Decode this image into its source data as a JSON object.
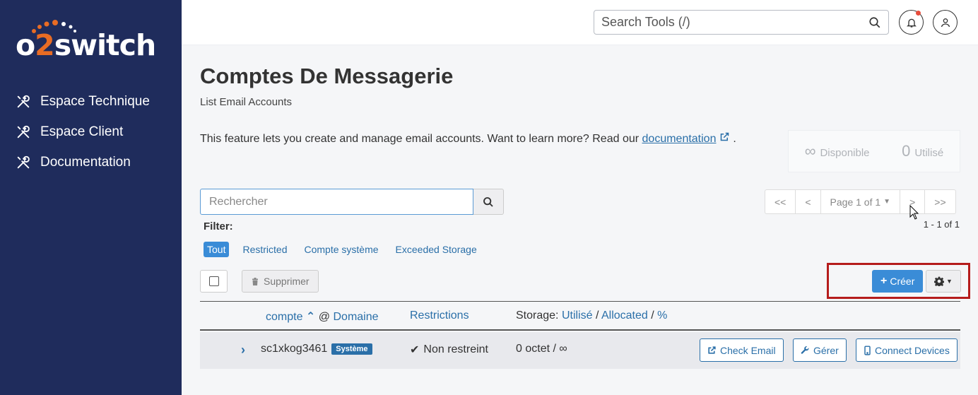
{
  "sidebar": {
    "brand": {
      "o": "o",
      "two": "2",
      "rest": "switch"
    },
    "items": [
      {
        "label": "Espace Technique",
        "icon": "tools-icon"
      },
      {
        "label": "Espace Client",
        "icon": "tools-icon"
      },
      {
        "label": "Documentation",
        "icon": "tools-icon"
      }
    ]
  },
  "topbar": {
    "search_placeholder": "Search Tools (/)"
  },
  "page": {
    "title": "Comptes De Messagerie",
    "subtitle": "List Email Accounts",
    "intro_text": "This feature lets you create and manage email accounts. Want to learn more? Read our ",
    "intro_link": "documentation",
    "intro_end": "."
  },
  "stats": {
    "available_symbol": "∞",
    "available_label": "Disponible",
    "used_value": "0",
    "used_label": "Utilisé"
  },
  "search": {
    "placeholder": "Rechercher"
  },
  "pager": {
    "first": "<<",
    "prev": "<",
    "page_label": "Page 1 of 1",
    "next": ">",
    "last": ">>",
    "result_count": "1 - 1 of 1"
  },
  "filter": {
    "label": "Filter:",
    "options": [
      "Tout",
      "Restricted",
      "Compte système",
      "Exceeded Storage"
    ]
  },
  "actions": {
    "delete": "Supprimer",
    "create": "Créer"
  },
  "table": {
    "headers": {
      "account": "compte",
      "at": "@",
      "domain": "Domaine",
      "restrictions": "Restrictions",
      "storage_prefix": "Storage:",
      "used": "Utilisé",
      "sep": "/",
      "allocated": "Allocated",
      "percent": "%"
    },
    "rows": [
      {
        "account": "sc1xkog3461",
        "badge": "Système",
        "restriction": "Non restreint",
        "storage": "0 octet / ∞",
        "check_email": "Check Email",
        "manage": "Gérer",
        "connect": "Connect Devices"
      }
    ]
  },
  "colors": {
    "sidebar_bg": "#1f2c5c",
    "accent": "#3a8cd7",
    "link": "#2a6fa8",
    "brand_orange": "#e86c24",
    "highlight": "#b51c1c"
  }
}
